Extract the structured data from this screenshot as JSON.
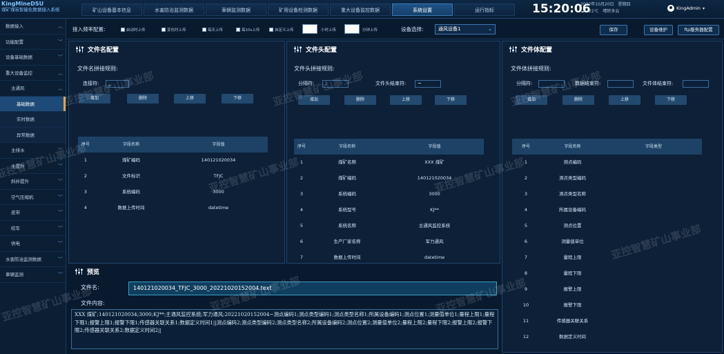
{
  "brand": {
    "en": "KingMineDSU",
    "cn": "煤矿煤炭智能化数据接入系统"
  },
  "nav_tabs": [
    "矿山设备基本信息",
    "水害防治监测数据",
    "車辆监测数据",
    "矿用设备检测数据",
    "重大设备监控数据",
    "系统设置",
    "运行指标"
  ],
  "clock": "15:20:06",
  "date": {
    "date": "2022年10月20日",
    "weekday": "星期四",
    "weather_icon": "☁",
    "temperature": "21℃",
    "weather": "晴转多云"
  },
  "user": {
    "name": "KingAdmin"
  },
  "sidebar": [
    {
      "label": "数据接入",
      "chevron": "︿"
    },
    {
      "label": "功能配置",
      "chevron": "﹀"
    },
    {
      "label": "设备基础数据",
      "chevron": "﹀"
    },
    {
      "label": "重大设备监控",
      "chevron": "︿"
    },
    {
      "label": "主通风",
      "chevron": "︿"
    },
    {
      "label": "基础数据",
      "chevron": ""
    },
    {
      "label": "实时数据",
      "chevron": ""
    },
    {
      "label": "异常数据",
      "chevron": ""
    },
    {
      "label": "主排水",
      "chevron": "﹀"
    },
    {
      "label": "主提升",
      "chevron": "﹀"
    },
    {
      "label": "斜井提升",
      "chevron": "﹀"
    },
    {
      "label": "空气压缩机",
      "chevron": "﹀"
    },
    {
      "label": "皮带",
      "chevron": "﹀"
    },
    {
      "label": "绞车",
      "chevron": "﹀"
    },
    {
      "label": "供电",
      "chevron": "﹀"
    },
    {
      "label": "水害防治监测数据",
      "chevron": "﹀"
    },
    {
      "label": "車辆监测",
      "chevron": "﹀"
    }
  ],
  "toolbar": {
    "freq_label": "接入频率配置:",
    "checkboxes": [
      "启动时上传",
      "变化时上传",
      "每天上传",
      "每10s上传",
      "自定义上传"
    ],
    "hour_label": "小时上传",
    "minute_label": "分钟上传",
    "device_label": "设备选择:",
    "device_value": "通风设备1",
    "save": "保存",
    "maintain": "设备维护",
    "ftp": "ftp服务器配置"
  },
  "filename_panel": {
    "title": "文件名配置",
    "rule": "文件名拼接规则:",
    "connector_label": "连接符:",
    "connector_value": "_",
    "buttons": [
      "增加",
      "删除",
      "上移",
      "下移"
    ],
    "headers": [
      "序号",
      "字段名称",
      "字段值"
    ],
    "rows": [
      [
        "1",
        "煤矿编码",
        "140121020034"
      ],
      [
        "2",
        "文件标识",
        "TFJC"
      ],
      [
        "3",
        "系统编码",
        "3000"
      ],
      [
        "4",
        "数据上传时间",
        "datetime"
      ]
    ]
  },
  "filehead_panel": {
    "title": "文件头配置",
    "rule": "文件头拼接规则:",
    "sep_label": "分隔符:",
    "sep_value": ";",
    "end_label": "文件头结束符:",
    "end_value": "~",
    "buttons": [
      "增加",
      "删除",
      "上移",
      "下移"
    ],
    "headers": [
      "序号",
      "字段名称",
      "字段值"
    ],
    "rows": [
      [
        "1",
        "煤矿名称",
        "XXX 煤矿"
      ],
      [
        "2",
        "煤矿编码",
        "140121020034"
      ],
      [
        "3",
        "系统编码",
        "3000"
      ],
      [
        "4",
        "系统型号",
        "KJ**"
      ],
      [
        "5",
        "系统名称",
        "主通风监控系统"
      ],
      [
        "6",
        "生产厂家名称",
        "军力通风"
      ],
      [
        "7",
        "数据上传时间",
        "datetime"
      ]
    ]
  },
  "filebody_panel": {
    "title": "文件体配置",
    "rule": "文件体拼接规则:",
    "sep_label": "分隔符:",
    "sep_value": "",
    "data_end_label": "数据结束符:",
    "data_end_value": "",
    "body_end_label": "文件体结束符:",
    "body_end_value": "",
    "buttons": [
      "增加",
      "删除",
      "上移",
      "下移"
    ],
    "headers": [
      "序号",
      "字段名称",
      "字段类型"
    ],
    "rows": [
      [
        "1",
        "测点编码",
        ""
      ],
      [
        "2",
        "测点类型编码",
        ""
      ],
      [
        "3",
        "测点类型名称",
        ""
      ],
      [
        "4",
        "所属设备编码",
        ""
      ],
      [
        "5",
        "测点位置",
        ""
      ],
      [
        "6",
        "测量值单位",
        ""
      ],
      [
        "7",
        "量程上限",
        ""
      ],
      [
        "8",
        "量程下限",
        ""
      ],
      [
        "9",
        "报警上限",
        ""
      ],
      [
        "10",
        "报警下限",
        ""
      ],
      [
        "11",
        "传感器关联关系",
        ""
      ],
      [
        "12",
        "数据定义时间",
        ""
      ]
    ]
  },
  "preview": {
    "title": "预览",
    "filename_label": "文件名:",
    "filename_value": "140121020034_TFJC_3000_20221020152004.text",
    "content_label": "文件内容:",
    "content": "XXX 煤矿;140121020034;3000;KJ**;主通风监控系统;军力通风;20221020152004~测点编码1;测点类型编码1;测点类型名称1;所属设备编码1;测点位置1;测量值单位1;量程上限1;量程下限1;报警上限1;报警下限1;传感器关联关系1;数据定义时间1||测点编码2;测点类型编码2;测点类型名称2;所属设备编码2;测点位置2;测量值单位2;量程上限2;量程下限2;报警上限2;报警下限2;传感器关联关系2;数据定义时间2||"
  },
  "watermark": "亚控智慧矿山事业部"
}
